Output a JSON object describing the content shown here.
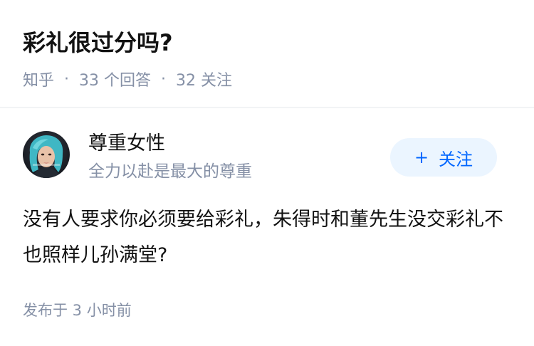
{
  "question": {
    "title": "彩礼很过分吗?",
    "meta": {
      "source": "知乎",
      "separator": "·",
      "answers": "33 个回答",
      "followers": "32 关注"
    }
  },
  "answer": {
    "author": {
      "name": "尊重女性",
      "bio": "全力以赴是最大的尊重",
      "avatar_icon": "user-avatar-photo"
    },
    "follow_button": {
      "icon": "plus-icon",
      "plus_symbol": "+",
      "label": "关注"
    },
    "content": "没有人要求你必须要给彩礼，朱得时和董先生没交彩礼不也照样儿孙满堂?",
    "published": "发布于 3 小时前"
  },
  "colors": {
    "primary_text": "#121212",
    "secondary_text": "#8590a6",
    "accent": "#0066ff",
    "accent_bg": "#ebf5ff",
    "divider": "#f2f3f5"
  }
}
